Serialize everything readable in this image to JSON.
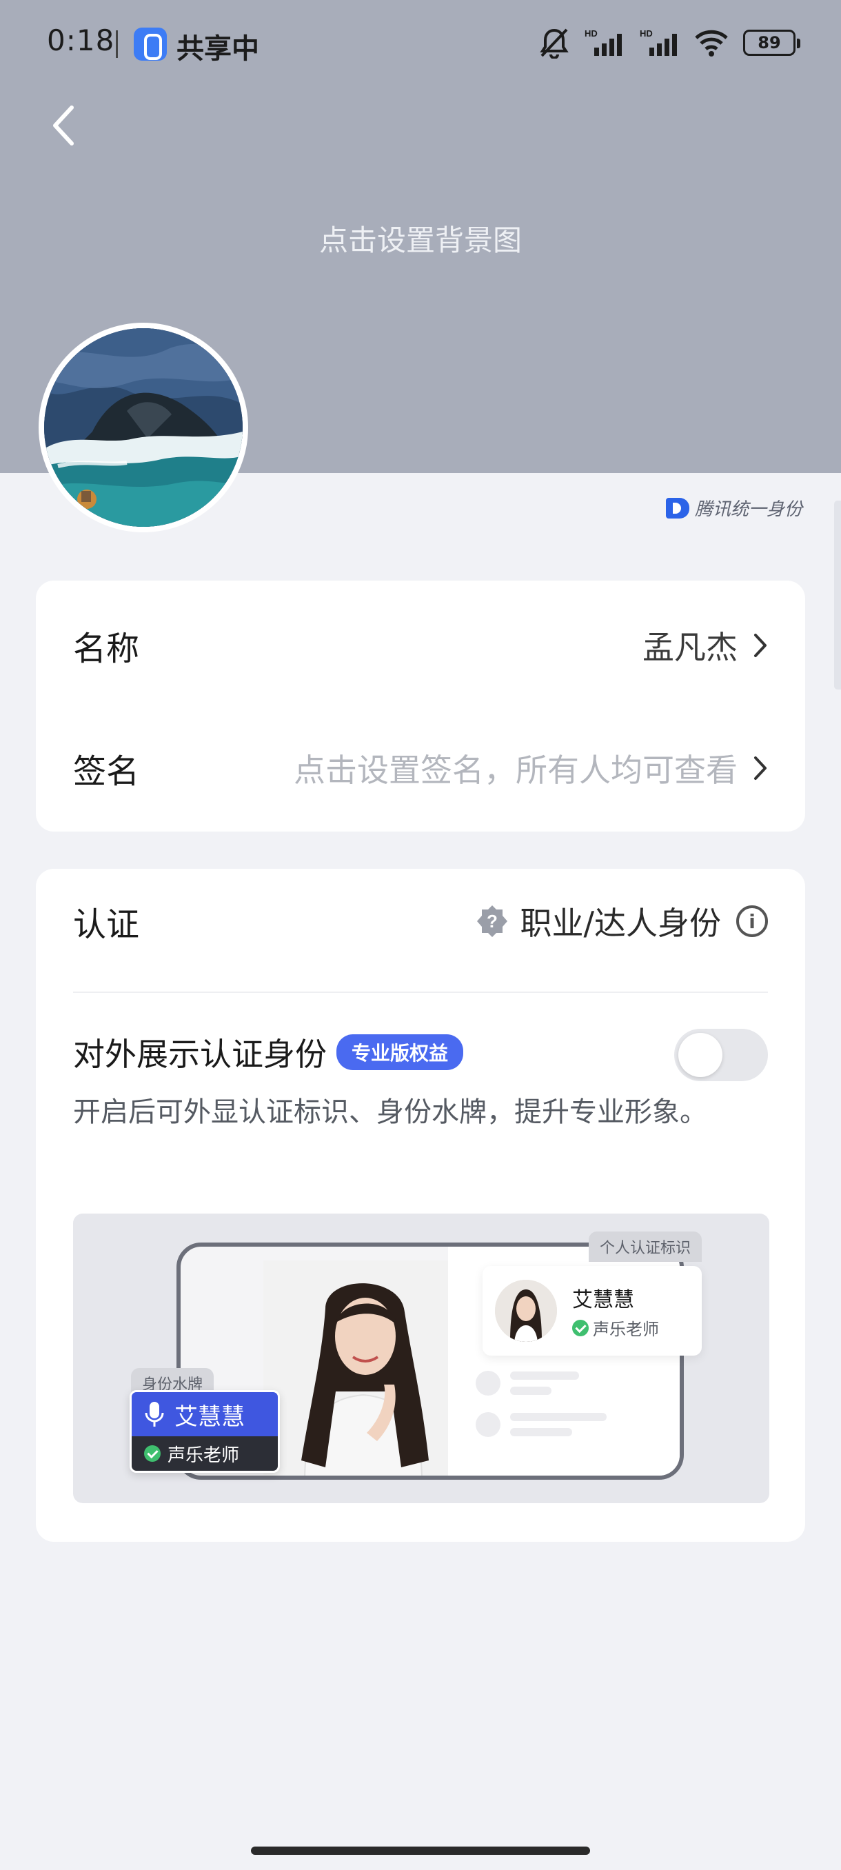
{
  "status_bar": {
    "time": "0:18",
    "sharing_label": "共享中",
    "hd1": "HD",
    "hd2": "HD",
    "battery": "89"
  },
  "header": {
    "background_hint": "点击设置背景图",
    "back_icon": "chevron-left-icon",
    "brand_label": "腾讯统一身份",
    "header_color": "#a8adba"
  },
  "profile": {
    "name_label": "名称",
    "name_value": "孟凡杰",
    "signature_label": "签名",
    "signature_placeholder": "点击设置签名，所有人均可查看"
  },
  "certification": {
    "label": "认证",
    "value": "职业/达人身份",
    "display_label": "对外展示认证身份",
    "pro_badge": "专业版权益",
    "toggle_on": false,
    "description": "开启后可外显认证标识、身份水牌，提升专业形象。",
    "accent_color": "#4a6af0"
  },
  "illustration": {
    "personal_tag": "个人认证标识",
    "watermark_tag": "身份水牌",
    "card_name": "艾慧慧",
    "card_role": "声乐老师",
    "watermark_name": "艾慧慧",
    "watermark_role": "声乐老师"
  }
}
